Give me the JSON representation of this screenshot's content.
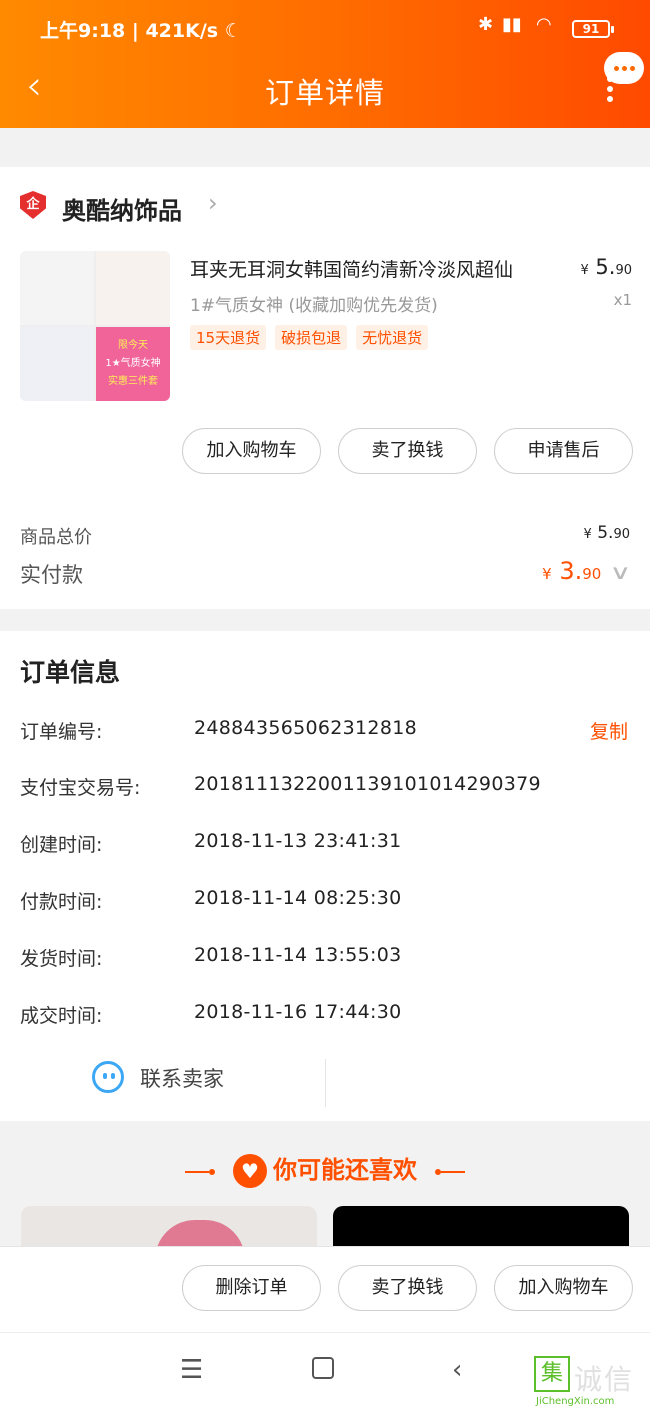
{
  "status_bar": {
    "time": "上午9:18",
    "speed": "421K/s",
    "battery": "91"
  },
  "header": {
    "title": "订单详情"
  },
  "shop": {
    "badge": "企",
    "name": "奥酷纳饰品"
  },
  "product": {
    "title": "耳夹无耳洞女韩国简约清新冷淡风超仙",
    "sku": "1#气质女神 (收藏加购优先发货)",
    "price_symbol": "¥",
    "price_int": "5.",
    "price_dec": "90",
    "qty": "x1",
    "tags": [
      "15天退货",
      "破损包退",
      "无忧退货"
    ],
    "image_text": [
      "限今天",
      "1★气质女神",
      "实惠三件套"
    ]
  },
  "item_actions": [
    "加入购物车",
    "卖了换钱",
    "申请售后"
  ],
  "summary": {
    "total_label": "商品总价",
    "total_symbol": "¥",
    "total_int": "5.",
    "total_dec": "90",
    "paid_label": "实付款",
    "paid_symbol": "¥",
    "paid_int": "3.",
    "paid_dec": "90"
  },
  "order_info": {
    "title": "订单信息",
    "rows": [
      {
        "label": "订单编号:",
        "value": "248843565062312818"
      },
      {
        "label": "支付宝交易号:",
        "value": "2018111322001139101014290379"
      },
      {
        "label": "创建时间:",
        "value": "2018-11-13 23:41:31"
      },
      {
        "label": "付款时间:",
        "value": "2018-11-14 08:25:30"
      },
      {
        "label": "发货时间:",
        "value": "2018-11-14 13:55:03"
      },
      {
        "label": "成交时间:",
        "value": "2018-11-16 17:44:30"
      }
    ],
    "copy_label": "复制",
    "contact_label": "联系卖家"
  },
  "recommend": {
    "title": "你可能还喜欢"
  },
  "bottom_actions": [
    "删除订单",
    "卖了换钱",
    "加入购物车"
  ],
  "watermark": {
    "char": "集",
    "text": "诚信",
    "url": "JiChengXin.com"
  },
  "colors": {
    "accent": "#ff5000",
    "header_start": "#ff8a00",
    "header_end": "#ff4a00",
    "link_blue": "#3ba7f5"
  }
}
